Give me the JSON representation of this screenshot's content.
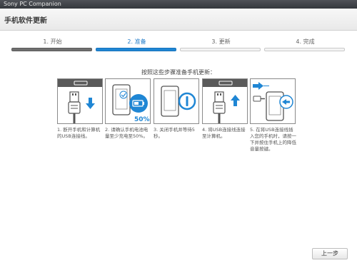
{
  "window": {
    "title": "Sony PC Companion"
  },
  "header": {
    "title": "手机软件更新"
  },
  "steps": [
    {
      "label": "1. 开始",
      "state": "done"
    },
    {
      "label": "2. 准备",
      "state": "active"
    },
    {
      "label": "3. 更新",
      "state": "pending"
    },
    {
      "label": "4. 完成",
      "state": "pending"
    }
  ],
  "instruction": "按照这些步骤准备手机更新：",
  "cards": [
    {
      "caption": "1. 断开手机和计算机的USB连接线。",
      "icons": [
        "usb-plug-icon",
        "arrow-down-icon"
      ]
    },
    {
      "caption": "2. 请确认手机电池电量至少充电至50%。",
      "icons": [
        "phone-icon",
        "battery-icon"
      ],
      "badge": "50%"
    },
    {
      "caption": "3. 关闭手机并等待5秒。",
      "icons": [
        "phone-icon",
        "power-icon"
      ]
    },
    {
      "caption": "4. 将USB连接线连接至计算机。",
      "icons": [
        "usb-plug-icon",
        "arrow-up-icon"
      ]
    },
    {
      "caption": "5. 在将USB连接线插入您的手机时，请按一下并按住手机上的降低音量按键。",
      "icons": [
        "arrow-right-icon",
        "phone-icon",
        "usb-plug-icon"
      ]
    }
  ],
  "footer": {
    "back_label": "上一步"
  },
  "colors": {
    "accent": "#1f86d4",
    "done": "#6f6f6f",
    "title_bar": "#3f4247"
  }
}
